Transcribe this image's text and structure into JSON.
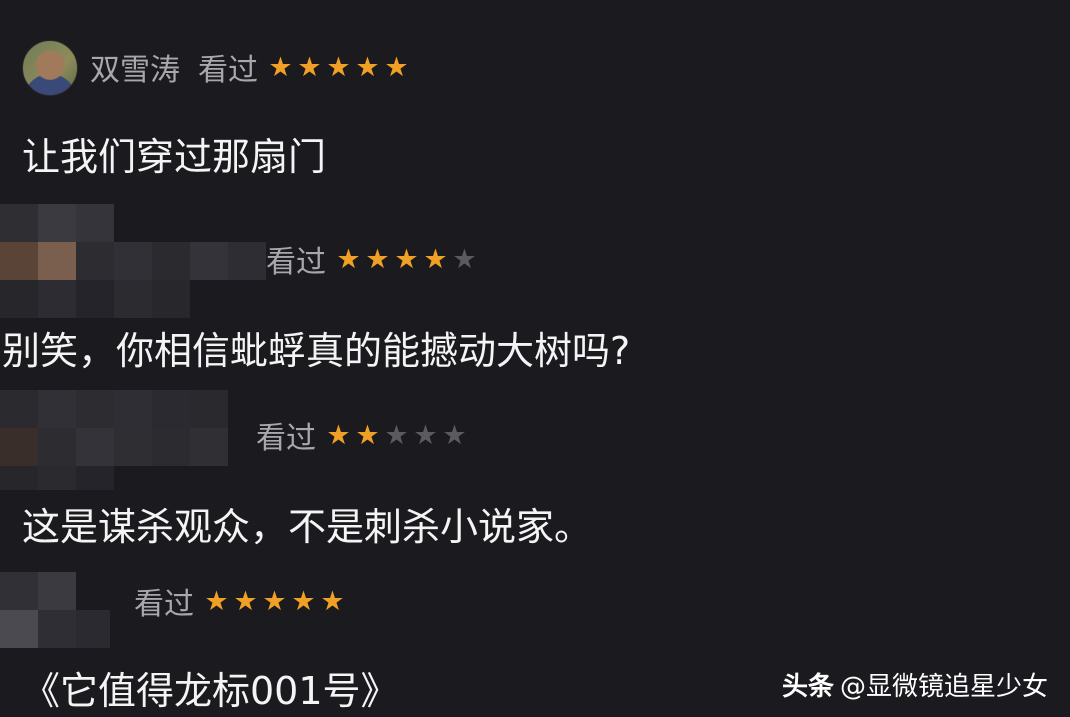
{
  "reviews": [
    {
      "username": "双雪涛",
      "status": "看过",
      "rating": 5,
      "max_rating": 5,
      "comment": "让我们穿过那扇门",
      "avatar": "user-photo"
    },
    {
      "username": "",
      "status": "看过",
      "rating": 4,
      "max_rating": 5,
      "comment": "别笑，你相信蚍蜉真的能撼动大树吗?",
      "avatar": "pixelated"
    },
    {
      "username": "",
      "status": "看过",
      "rating": 2,
      "max_rating": 5,
      "comment": "这是谋杀观众，不是刺杀小说家。",
      "avatar": "pixelated"
    },
    {
      "username": "",
      "status": "看过",
      "rating": 5,
      "max_rating": 5,
      "comment": "《它值得龙标001号》",
      "avatar": "pixelated"
    }
  ],
  "watermark": {
    "brand": "头条",
    "handle": "@显微镜追星少女"
  },
  "colors": {
    "background": "#1b1b1f",
    "star_on": "#f0a024",
    "star_off": "#5a5a60",
    "meta_text": "#a8a8ac",
    "comment_text": "#f4f4f4"
  }
}
